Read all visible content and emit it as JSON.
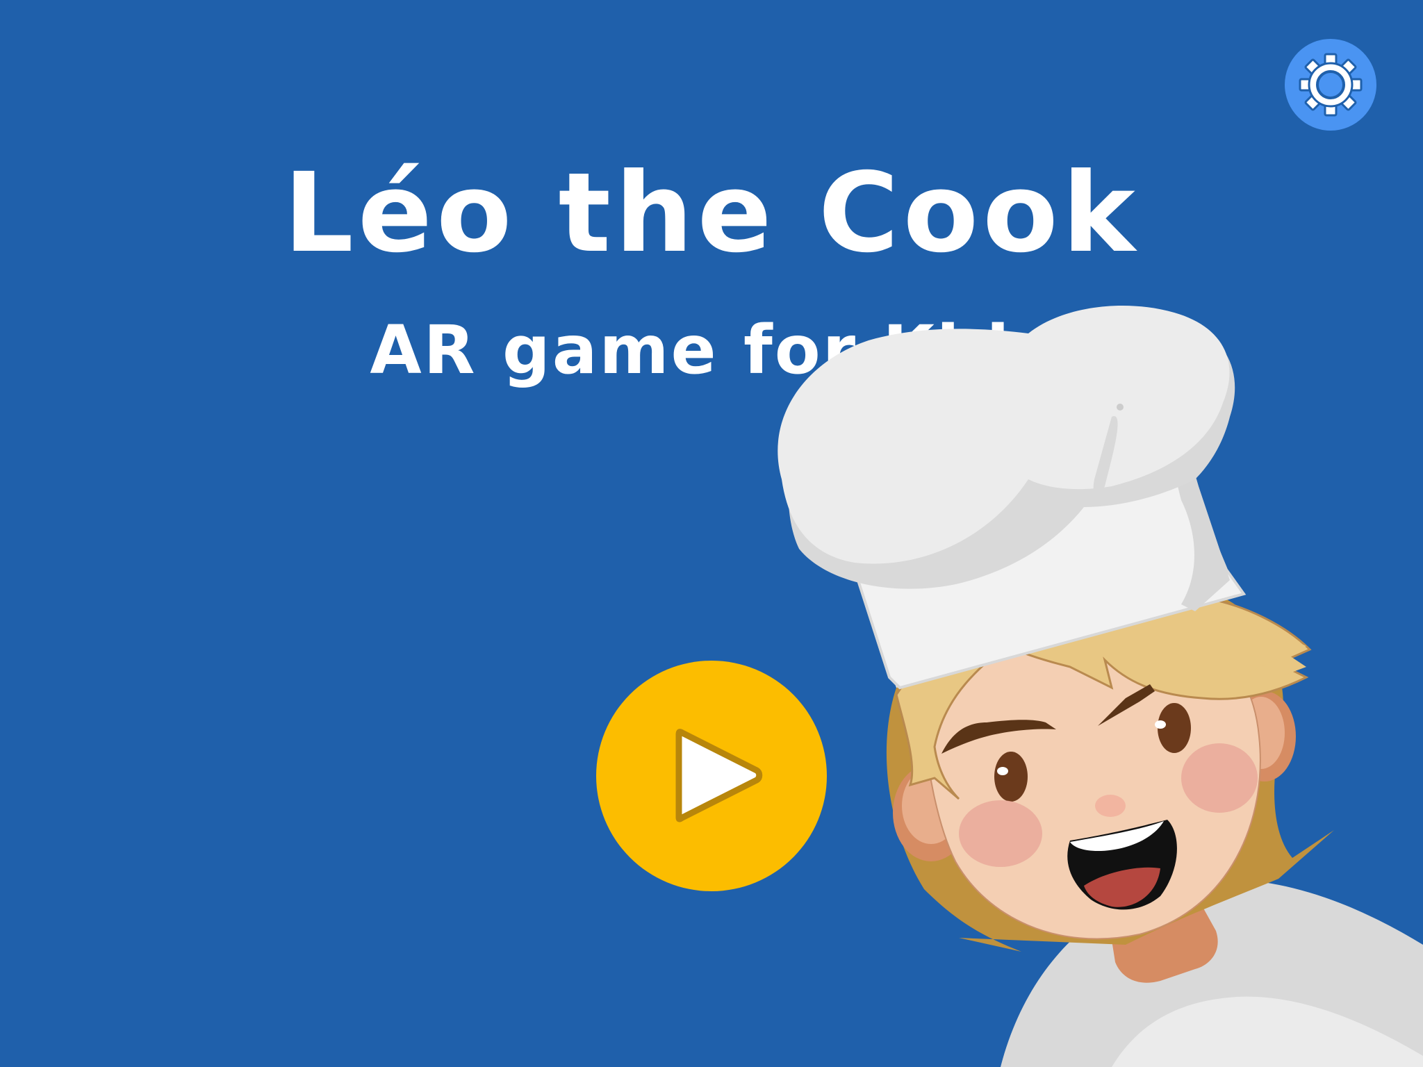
{
  "title": "Léo the Cook",
  "subtitle": "AR game for Kids",
  "buttons": {
    "play": {
      "icon": "play-icon"
    },
    "settings": {
      "icon": "gear-icon"
    }
  },
  "character": {
    "name": "chef-character"
  },
  "colors": {
    "background": "#1f60ab",
    "play_button": "#fcbd00",
    "settings_button": "#4a94f2",
    "text": "#ffffff"
  }
}
